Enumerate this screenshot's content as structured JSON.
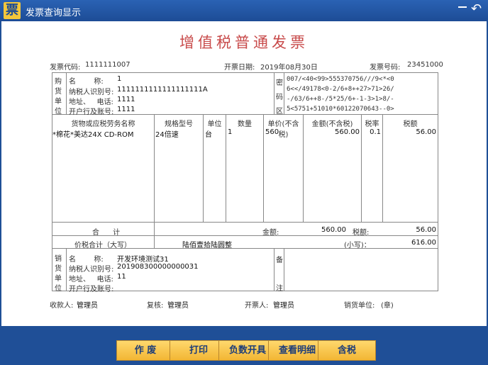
{
  "window": {
    "title": "发票查询显示",
    "logo_char": "票",
    "back_symbol": "↶"
  },
  "invoice": {
    "title": "增值税普通发票",
    "code_label": "发票代码:",
    "code": "1111111007",
    "date_label": "开票日期:",
    "date": "2019年08月30日",
    "number_label": "发票号码:",
    "number": "23451000",
    "buyer": {
      "section_chars": [
        "购",
        "货",
        "单",
        "位"
      ],
      "name_label": "名        称:",
      "name": "1",
      "tax_id_label": "纳税人识别号:",
      "tax_id": "1111111111111111111A",
      "address_label": "地址、   电话:",
      "address": "1111",
      "bank_label": "开户行及账号:",
      "bank": "1111"
    },
    "cipher": {
      "section_chars": [
        "密",
        "码",
        "区"
      ],
      "lines": [
        "007/<40<99>555370756///9<*<0",
        "6<</49178<0-2/6+8++27>71>26/",
        "-/63/6++8-/5*25/6+-1-3>1>8/-",
        "5<5751+51010*60122070643--0>"
      ]
    },
    "columns": {
      "goods": "货物或应税劳务名称",
      "spec": "规格型号",
      "unit": "单位",
      "qty": "数量",
      "price": "单价(不含税)",
      "amount": "金额(不含税)",
      "rate": "税率",
      "tax": "税额"
    },
    "item": {
      "goods": "*棉花*美达24X CD-ROM",
      "spec": "24倍速",
      "unit": "台",
      "qty": "1",
      "price": "560",
      "amount": "560.00",
      "rate": "0.1",
      "tax": "56.00"
    },
    "total": {
      "label": "合      计",
      "amount_label": "金额:",
      "amount": "560.00",
      "tax_label": "税额:",
      "tax": "56.00"
    },
    "grand_total": {
      "label": "价税合计（大写）",
      "upper": "陆佰壹拾陆圆整",
      "lower_label": "(小写)：",
      "lower": "616.00"
    },
    "seller": {
      "section_chars": [
        "销",
        "货",
        "单",
        "位"
      ],
      "name_label": "名        称:",
      "name": "开发环境测试31",
      "tax_id_label": "纳税人识别号:",
      "tax_id": "201908300000000031",
      "address_label": "地址、   电话:",
      "address": "11",
      "bank_label": "开户行及账号:",
      "bank": ""
    },
    "remarks_chars": [
      "备",
      "注"
    ],
    "footer": {
      "payee_label": "收款人:",
      "payee": "管理员",
      "reviewer_label": "复核:",
      "reviewer": "管理员",
      "drawer_label": "开票人:",
      "drawer": "管理员",
      "seller_label": "销货单位:",
      "seller_stamp": "(章)"
    }
  },
  "buttons": {
    "void": "作 废",
    "print": "打印",
    "negative": "负数开具",
    "details": "查看明细",
    "tax_included": "含税"
  }
}
